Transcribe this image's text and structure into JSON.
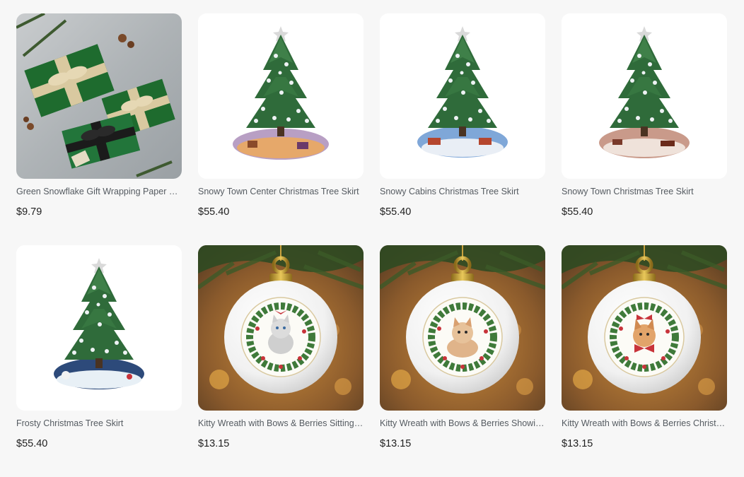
{
  "products": [
    {
      "title": "Green Snowflake Gift Wrapping Paper Rolls",
      "price": "$9.79",
      "image": "gift-wrap-photo"
    },
    {
      "title": "Snowy Town Center Christmas Tree Skirt",
      "price": "$55.40",
      "image": "tree-skirt-town-center"
    },
    {
      "title": "Snowy Cabins Christmas Tree Skirt",
      "price": "$55.40",
      "image": "tree-skirt-cabins"
    },
    {
      "title": "Snowy Town Christmas Tree Skirt",
      "price": "$55.40",
      "image": "tree-skirt-town"
    },
    {
      "title": "Frosty Christmas Tree Skirt",
      "price": "$55.40",
      "image": "tree-skirt-frosty"
    },
    {
      "title": "Kitty Wreath with Bows & Berries Sitting Ornament",
      "price": "$13.15",
      "image": "ornament-kitty-sitting"
    },
    {
      "title": "Kitty Wreath with Bows & Berries Showing Ornament",
      "price": "$13.15",
      "image": "ornament-kitty-showing"
    },
    {
      "title": "Kitty Wreath with Bows & Berries Christmas Ornament",
      "price": "$13.15",
      "image": "ornament-kitty-christmas"
    }
  ],
  "colors": {
    "background": "#f7f7f7",
    "title_text": "#555b61",
    "price_text": "#1f1f1f",
    "tree_green": "#2f6b3a",
    "gift_green": "#1e6b2e"
  }
}
